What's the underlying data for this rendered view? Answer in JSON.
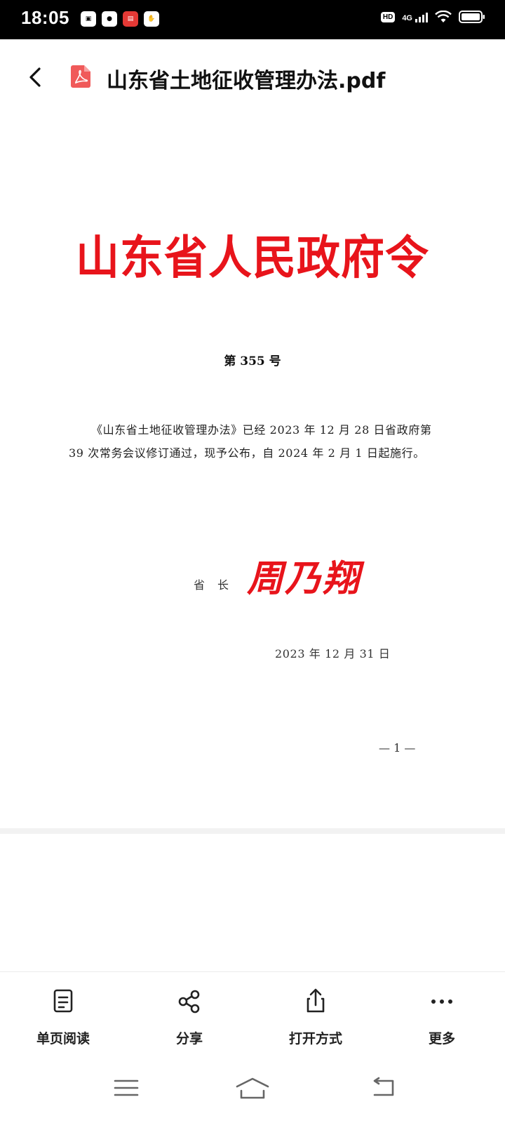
{
  "status_bar": {
    "time": "18:05",
    "notifications": [
      "app-1",
      "baidu",
      "news",
      "hand"
    ],
    "hd_label": "HD",
    "network": "4G"
  },
  "header": {
    "title": "山东省土地征收管理办法.pdf",
    "accent_color": "#f05a5a"
  },
  "document": {
    "decree_title": "山东省人民政府令",
    "decree_number": "第 355 号",
    "body": "《山东省土地征收管理办法》已经 2023 年 12 月 28 日省政府第 39 次常务会议修订通过，现予公布，自 2024 年 2 月 1 日起施行。",
    "signer_label": "省长",
    "signature": "周乃翔",
    "date": "2023 年 12 月 31 日",
    "page_number": "— 1 —",
    "red_color": "#e8141b"
  },
  "toolbar": {
    "items": [
      {
        "label": "单页阅读",
        "icon": "page-icon"
      },
      {
        "label": "分享",
        "icon": "share-icon"
      },
      {
        "label": "打开方式",
        "icon": "export-icon"
      },
      {
        "label": "更多",
        "icon": "more-icon"
      }
    ]
  },
  "nav_bar": {
    "buttons": [
      "menu",
      "home",
      "back"
    ]
  }
}
